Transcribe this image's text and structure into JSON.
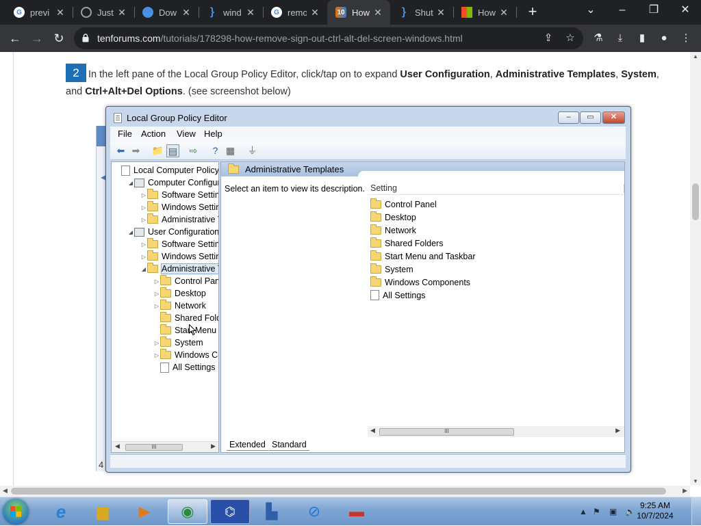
{
  "browser": {
    "tabs": [
      {
        "title": "previ",
        "icon": "google-icon",
        "color": "#ffffff",
        "active": false
      },
      {
        "title": "Just a",
        "icon": "globe-icon",
        "color": "#9aa0a6",
        "active": false
      },
      {
        "title": "Dow",
        "icon": "download-site-icon",
        "color": "#4a90e2",
        "active": false
      },
      {
        "title": "wind",
        "icon": "bracket-icon",
        "color": "#4a90e2",
        "active": false
      },
      {
        "title": "remo",
        "icon": "google-icon",
        "color": "#ffffff",
        "active": false
      },
      {
        "title": "How",
        "icon": "tenforums-icon",
        "color": "#e8710a",
        "active": true
      },
      {
        "title": "Shut",
        "icon": "bracket-icon",
        "color": "#4a90e2",
        "active": false
      },
      {
        "title": "How",
        "icon": "microsoft-icon",
        "color": "#f25022",
        "active": false
      }
    ],
    "url_host": "tenforums.com",
    "url_path": "/tutorials/178298-how-remove-sign-out-ctrl-alt-del-screen-windows.html"
  },
  "article": {
    "step_number": "2",
    "text_1": "In the left pane of the Local Group Policy Editor, click/tap on to expand ",
    "bold_1": "User Configuration",
    "sep_1": ", ",
    "bold_2": "Administrative Templates",
    "sep_2": ", ",
    "bold_3": "System",
    "sep_3": ", and ",
    "bold_4": "Ctrl+Alt+Del Options",
    "text_2": ". (see screenshot below)"
  },
  "gpedit": {
    "title": "Local Group Policy Editor",
    "menu": [
      "File",
      "Action",
      "View",
      "Help"
    ],
    "bg_window_number": "4",
    "tree": [
      {
        "label": "Local Computer Policy",
        "level": 0,
        "arrow": "",
        "icon": "doc"
      },
      {
        "label": "Computer Configura",
        "level": 1,
        "arrow": "◢",
        "icon": "pc"
      },
      {
        "label": "Software Settings",
        "level": 2,
        "arrow": "▷",
        "icon": "folder"
      },
      {
        "label": "Windows Setting",
        "level": 2,
        "arrow": "▷",
        "icon": "folder"
      },
      {
        "label": "Administrative Te",
        "level": 2,
        "arrow": "▷",
        "icon": "folder"
      },
      {
        "label": "User Configuration",
        "level": 1,
        "arrow": "◢",
        "icon": "pc"
      },
      {
        "label": "Software Settings",
        "level": 2,
        "arrow": "▷",
        "icon": "folder"
      },
      {
        "label": "Windows Setting",
        "level": 2,
        "arrow": "▷",
        "icon": "folder"
      },
      {
        "label": "Administrative Te",
        "level": 2,
        "arrow": "◢",
        "icon": "folder",
        "selected": true
      },
      {
        "label": "Control Panel",
        "level": 3,
        "arrow": "▷",
        "icon": "folder"
      },
      {
        "label": "Desktop",
        "level": 3,
        "arrow": "▷",
        "icon": "folder"
      },
      {
        "label": "Network",
        "level": 3,
        "arrow": "▷",
        "icon": "folder"
      },
      {
        "label": "Shared Folder",
        "level": 3,
        "arrow": "",
        "icon": "folder"
      },
      {
        "label": "Start Menu ar",
        "level": 3,
        "arrow": "",
        "icon": "folder"
      },
      {
        "label": "System",
        "level": 3,
        "arrow": "▷",
        "icon": "folder"
      },
      {
        "label": "Windows Cor",
        "level": 3,
        "arrow": "▷",
        "icon": "folder"
      },
      {
        "label": "All Settings",
        "level": 3,
        "arrow": "",
        "icon": "doc"
      }
    ],
    "right_header": "Administrative Templates",
    "description": "Select an item to view its description.",
    "column_header": "Setting",
    "list": [
      {
        "label": "Control Panel",
        "icon": "folder"
      },
      {
        "label": "Desktop",
        "icon": "folder"
      },
      {
        "label": "Network",
        "icon": "folder"
      },
      {
        "label": "Shared Folders",
        "icon": "folder"
      },
      {
        "label": "Start Menu and Taskbar",
        "icon": "folder"
      },
      {
        "label": "System",
        "icon": "folder"
      },
      {
        "label": "Windows Components",
        "icon": "folder"
      },
      {
        "label": "All Settings",
        "icon": "doc"
      }
    ],
    "tab_extended": "Extended",
    "tab_standard": "Standard",
    "scroll_grip": "III"
  },
  "taskbar": {
    "time": "9:25 AM",
    "date": "10/7/2024"
  }
}
